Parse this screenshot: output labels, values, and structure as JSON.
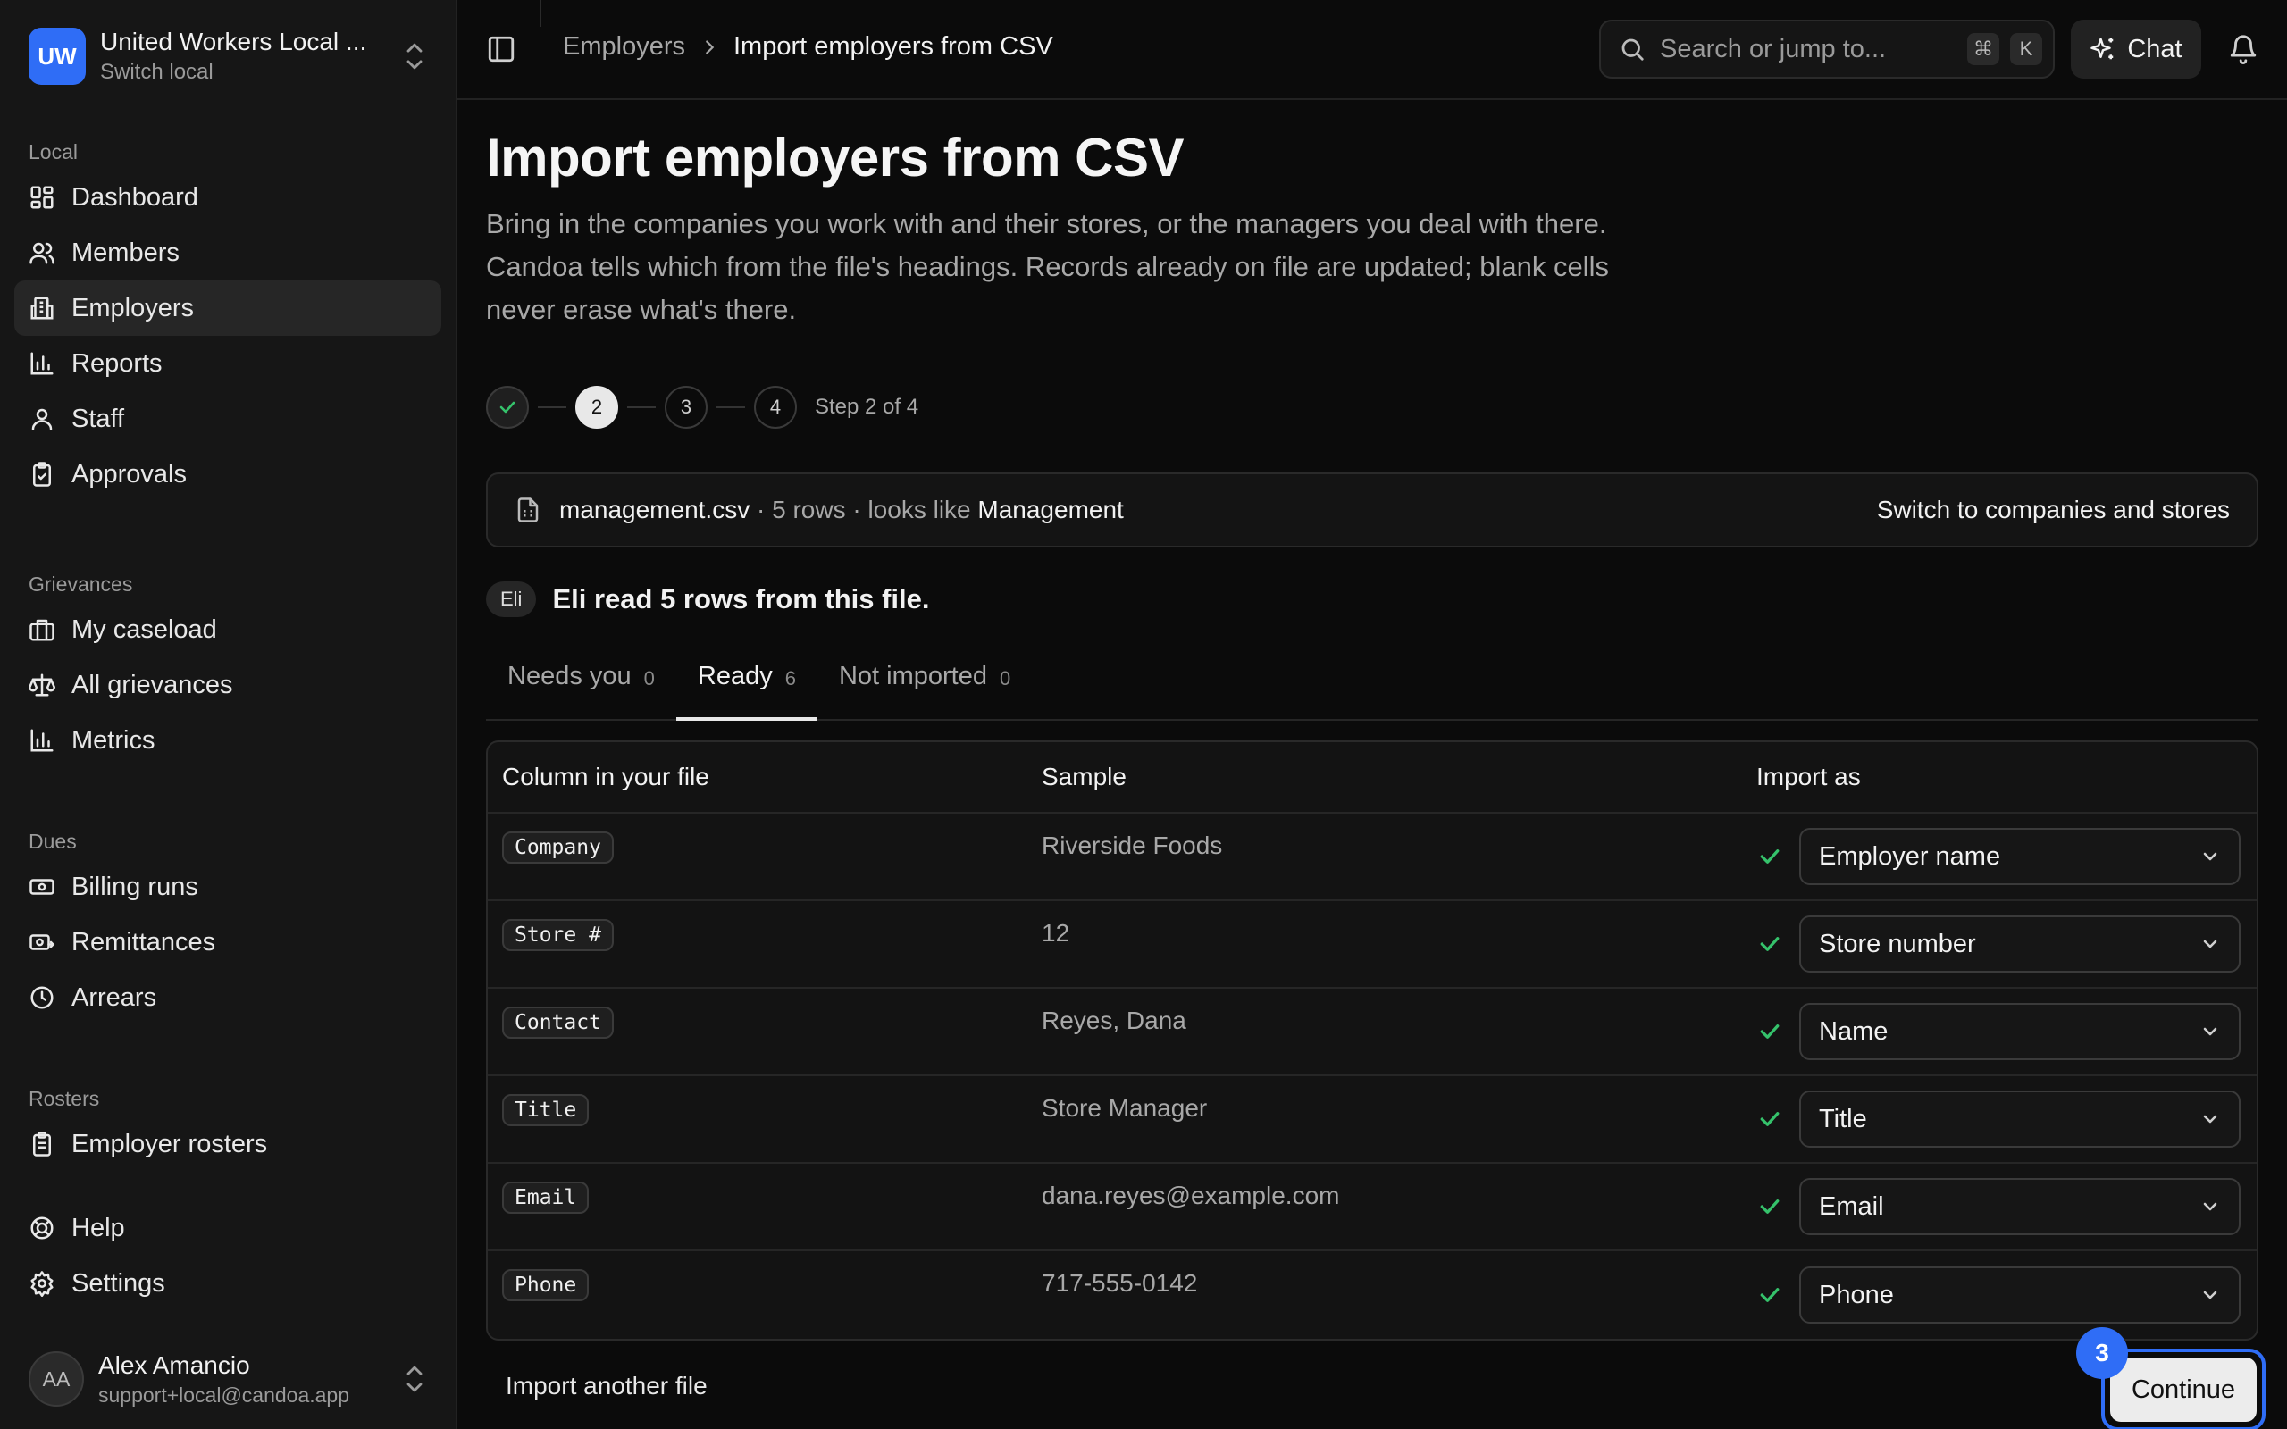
{
  "workspace": {
    "initials": "UW",
    "name": "United Workers Local ...",
    "subtitle": "Switch local"
  },
  "nav": {
    "local": {
      "heading": "Local",
      "items": [
        "Dashboard",
        "Members",
        "Employers",
        "Reports",
        "Staff",
        "Approvals"
      ]
    },
    "grievances": {
      "heading": "Grievances",
      "items": [
        "My caseload",
        "All grievances",
        "Metrics"
      ]
    },
    "dues": {
      "heading": "Dues",
      "items": [
        "Billing runs",
        "Remittances",
        "Arrears"
      ]
    },
    "rosters": {
      "heading": "Rosters",
      "items": [
        "Employer rosters"
      ]
    },
    "bottom": [
      "Help",
      "Settings"
    ]
  },
  "user": {
    "initials": "AA",
    "name": "Alex Amancio",
    "email": "support+local@candoa.app"
  },
  "topbar": {
    "breadcrumb": [
      "Employers",
      "Import employers from CSV"
    ],
    "search_placeholder": "Search or jump to...",
    "kbd": [
      "⌘",
      "K"
    ],
    "chat_label": "Chat"
  },
  "page": {
    "title": "Import employers from CSV",
    "description": "Bring in the companies you work with and their stores, or the managers you deal with there. Candoa tells which from the file's headings. Records already on file are updated; blank cells never erase what's there."
  },
  "stepper": {
    "steps": [
      "2",
      "3",
      "4"
    ],
    "label": "Step 2 of 4"
  },
  "file": {
    "name": "management.csv",
    "meta": " · 5 rows · looks like ",
    "kind": "Management",
    "switch_label": "Switch to companies and stores"
  },
  "eli": {
    "badge": "Eli",
    "message": "Eli read 5 rows from this file."
  },
  "tabs": [
    {
      "label": "Needs you",
      "count": "0"
    },
    {
      "label": "Ready",
      "count": "6"
    },
    {
      "label": "Not imported",
      "count": "0"
    }
  ],
  "table": {
    "headers": [
      "Column in your file",
      "Sample",
      "Import as"
    ],
    "rows": [
      {
        "column": "Company",
        "sample": "Riverside Foods",
        "import_as": "Employer name"
      },
      {
        "column": "Store #",
        "sample": "12",
        "import_as": "Store number"
      },
      {
        "column": "Contact",
        "sample": "Reyes, Dana",
        "import_as": "Name"
      },
      {
        "column": "Title",
        "sample": "Store Manager",
        "import_as": "Title"
      },
      {
        "column": "Email",
        "sample": "dana.reyes@example.com",
        "import_as": "Email"
      },
      {
        "column": "Phone",
        "sample": "717-555-0142",
        "import_as": "Phone"
      }
    ]
  },
  "footer": {
    "import_another": "Import another file",
    "continue": "Continue",
    "badge": "3"
  },
  "colors": {
    "accent": "#2f6df6",
    "success": "#35c26b"
  }
}
